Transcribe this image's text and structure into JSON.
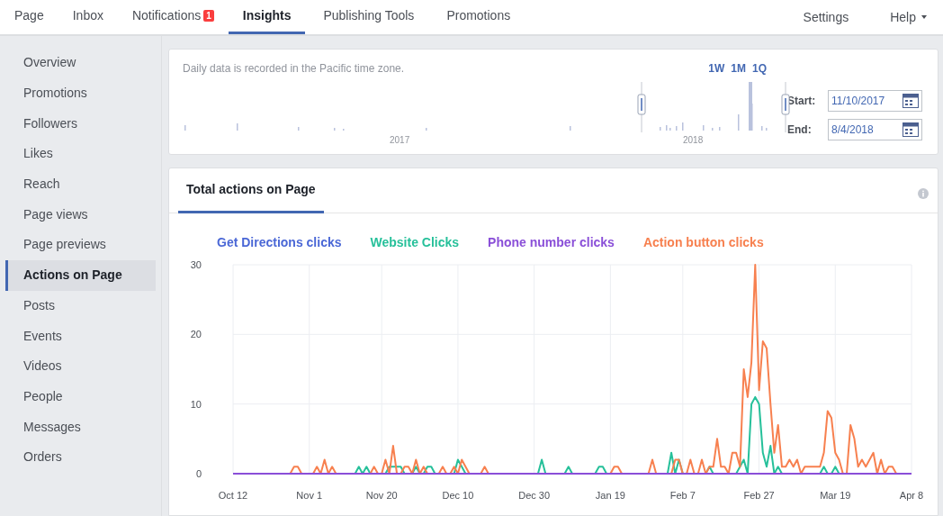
{
  "nav": {
    "tabs": [
      {
        "label": "Page",
        "selected": false
      },
      {
        "label": "Inbox",
        "selected": false
      },
      {
        "label": "Notifications",
        "badge": "1",
        "selected": false
      },
      {
        "label": "Insights",
        "selected": true
      },
      {
        "label": "Publishing Tools",
        "selected": false
      },
      {
        "label": "Promotions",
        "selected": false
      }
    ],
    "right": [
      {
        "label": "Settings",
        "kind": "link"
      },
      {
        "label": "Help",
        "kind": "menu"
      }
    ]
  },
  "sidebar": {
    "items": [
      {
        "label": "Overview",
        "selected": false
      },
      {
        "label": "Promotions",
        "selected": false
      },
      {
        "label": "Followers",
        "selected": false
      },
      {
        "label": "Likes",
        "selected": false
      },
      {
        "label": "Reach",
        "selected": false
      },
      {
        "label": "Page views",
        "selected": false
      },
      {
        "label": "Page previews",
        "selected": false
      },
      {
        "label": "Actions on Page",
        "selected": true
      },
      {
        "label": "Posts",
        "selected": false
      },
      {
        "label": "Events",
        "selected": false
      },
      {
        "label": "Videos",
        "selected": false
      },
      {
        "label": "People",
        "selected": false
      },
      {
        "label": "Messages",
        "selected": false
      },
      {
        "label": "Orders",
        "selected": false
      }
    ]
  },
  "range_card": {
    "note": "Daily data is recorded in the Pacific time zone.",
    "presets": [
      "1W",
      "1M",
      "1Q"
    ],
    "years": [
      "2017",
      "2018"
    ],
    "start": {
      "label": "Start:",
      "value": "11/10/2017"
    },
    "end": {
      "label": "End:",
      "value": "8/4/2018"
    }
  },
  "insights_card": {
    "tab": "Total actions on Page",
    "chart_data": {
      "type": "line",
      "categories": [
        "Oct 12",
        null,
        null,
        null,
        null,
        null,
        null,
        null,
        null,
        null,
        null,
        null,
        null,
        null,
        null,
        null,
        null,
        null,
        null,
        null,
        "Nov 1",
        null,
        null,
        null,
        null,
        null,
        null,
        null,
        null,
        null,
        null,
        null,
        null,
        null,
        null,
        null,
        null,
        null,
        null,
        "Nov 20",
        null,
        null,
        null,
        null,
        null,
        null,
        null,
        null,
        null,
        null,
        null,
        null,
        null,
        null,
        null,
        null,
        null,
        null,
        null,
        "Dec 10",
        null,
        null,
        null,
        null,
        null,
        null,
        null,
        null,
        null,
        null,
        null,
        null,
        null,
        null,
        null,
        null,
        null,
        null,
        null,
        "Dec 30",
        null,
        null,
        null,
        null,
        null,
        null,
        null,
        null,
        null,
        null,
        null,
        null,
        null,
        null,
        null,
        null,
        null,
        null,
        null,
        "Jan 19",
        null,
        null,
        null,
        null,
        null,
        null,
        null,
        null,
        null,
        null,
        null,
        null,
        null,
        null,
        null,
        null,
        null,
        null,
        "Feb 7",
        null,
        null,
        null,
        null,
        null,
        null,
        null,
        null,
        null,
        null,
        null,
        null,
        null,
        null,
        null,
        null,
        null,
        null,
        null,
        "Feb 27",
        null,
        null,
        null,
        null,
        null,
        null,
        null,
        null,
        null,
        null,
        null,
        null,
        null,
        null,
        null,
        null,
        null,
        null,
        null,
        "Mar 19",
        null,
        null,
        null,
        null,
        null,
        null,
        null,
        null,
        null,
        null,
        null,
        null,
        null,
        null,
        null,
        null,
        null,
        null,
        null,
        "Apr 8"
      ],
      "ylim": [
        0,
        30
      ],
      "yticks": [
        0,
        10,
        20,
        30
      ],
      "series": [
        {
          "name": "Get Directions clicks",
          "color": "#4a67d6",
          "values": [
            null,
            null,
            null,
            null,
            null,
            null,
            null,
            null,
            null,
            null,
            null,
            null,
            null,
            null,
            null,
            null,
            null,
            null,
            null,
            null,
            null,
            null,
            null,
            null,
            null,
            null,
            null,
            null,
            null,
            null,
            null,
            null,
            null,
            null,
            null,
            null,
            null,
            null,
            null,
            null,
            null,
            null,
            null,
            null,
            null,
            null,
            null,
            null,
            null,
            null,
            null,
            null,
            null,
            null,
            null,
            null,
            null,
            null,
            null,
            null,
            null,
            null,
            null,
            null,
            null,
            null,
            null,
            null,
            null,
            null,
            null,
            null,
            null,
            null,
            null,
            null,
            null,
            null,
            null,
            null,
            null,
            null,
            null,
            null,
            null,
            null,
            null,
            null,
            null,
            null,
            null,
            null,
            null,
            null,
            null,
            null,
            null,
            null,
            null,
            null,
            null,
            null,
            null,
            null,
            null,
            null,
            null,
            null,
            null,
            null,
            null,
            null,
            null,
            null,
            null,
            null,
            null,
            null,
            null,
            null,
            null,
            null,
            null,
            null,
            null,
            null,
            null,
            null,
            null,
            null,
            null,
            null,
            null,
            null,
            null,
            null,
            null,
            null,
            null,
            null,
            null,
            null,
            null,
            null,
            null,
            null,
            null,
            null,
            null,
            null,
            null,
            null,
            null,
            null,
            null,
            null,
            null,
            null,
            null,
            null,
            null,
            null,
            null,
            null,
            null,
            null,
            null,
            null,
            null,
            null,
            null,
            null,
            null,
            null,
            null,
            null,
            null,
            null,
            null
          ]
        },
        {
          "name": "Website Clicks",
          "color": "#26c09a",
          "values": [
            null,
            null,
            null,
            null,
            null,
            null,
            null,
            null,
            null,
            null,
            null,
            null,
            null,
            null,
            null,
            null,
            null,
            null,
            null,
            null,
            null,
            null,
            null,
            null,
            null,
            null,
            null,
            null,
            null,
            null,
            null,
            null,
            0,
            1,
            0,
            1,
            0,
            null,
            null,
            null,
            0,
            1,
            1,
            1,
            1,
            0,
            null,
            0,
            1,
            0,
            0,
            1,
            1,
            0,
            null,
            null,
            null,
            null,
            0,
            2,
            1,
            0,
            null,
            null,
            null,
            null,
            null,
            null,
            null,
            null,
            null,
            null,
            null,
            null,
            null,
            null,
            null,
            null,
            null,
            null,
            0,
            2,
            0,
            null,
            null,
            null,
            null,
            0,
            1,
            0,
            null,
            null,
            null,
            null,
            null,
            0,
            1,
            1,
            0,
            null,
            null,
            null,
            null,
            null,
            null,
            null,
            null,
            null,
            null,
            null,
            null,
            null,
            null,
            null,
            0,
            3,
            0,
            2,
            0,
            null,
            null,
            null,
            null,
            null,
            0,
            1,
            0,
            null,
            null,
            null,
            null,
            null,
            0,
            1,
            2,
            0,
            10,
            11,
            10,
            3,
            1,
            4,
            0,
            1,
            0,
            null,
            null,
            null,
            null,
            null,
            null,
            null,
            null,
            null,
            0,
            1,
            0,
            0,
            1,
            0,
            null,
            null,
            null,
            null,
            null,
            null,
            null,
            null,
            null,
            null,
            null,
            null,
            null,
            null,
            null,
            null,
            null,
            null,
            null
          ]
        },
        {
          "name": "Phone number clicks",
          "color": "#8a4fd8",
          "values": [
            0,
            0,
            0,
            0,
            0,
            0,
            0,
            0,
            0,
            0,
            0,
            0,
            0,
            0,
            0,
            0,
            0,
            0,
            0,
            0,
            0,
            0,
            0,
            0,
            0,
            0,
            0,
            0,
            0,
            0,
            0,
            0,
            0,
            0,
            0,
            0,
            0,
            0,
            0,
            0,
            0,
            0,
            0,
            0,
            0,
            0,
            0,
            0,
            0,
            0,
            0,
            0,
            0,
            0,
            0,
            0,
            0,
            0,
            0,
            0,
            0,
            0,
            0,
            0,
            0,
            0,
            0,
            0,
            0,
            0,
            0,
            0,
            0,
            0,
            0,
            0,
            0,
            0,
            0,
            0,
            0,
            0,
            0,
            0,
            0,
            0,
            0,
            0,
            0,
            0,
            0,
            0,
            0,
            0,
            0,
            0,
            0,
            0,
            0,
            0,
            0,
            0,
            0,
            0,
            0,
            0,
            0,
            0,
            0,
            0,
            0,
            0,
            0,
            0,
            0,
            0,
            0,
            0,
            0,
            0,
            0,
            0,
            0,
            0,
            0,
            0,
            0,
            0,
            0,
            0,
            0,
            0,
            0,
            0,
            0,
            0,
            0,
            0,
            0,
            0,
            0,
            0,
            0,
            0,
            0,
            0,
            0,
            0,
            0,
            0,
            0,
            0,
            0,
            0,
            0,
            0,
            0,
            0,
            0,
            0,
            0,
            0,
            0,
            0,
            0,
            0,
            0,
            0,
            0,
            0,
            0,
            0,
            0,
            0,
            0,
            0,
            0,
            0,
            0
          ]
        },
        {
          "name": "Action button clicks",
          "color": "#f7804f",
          "values": [
            null,
            null,
            null,
            null,
            null,
            null,
            null,
            null,
            null,
            null,
            null,
            null,
            null,
            null,
            null,
            0,
            1,
            1,
            0,
            null,
            null,
            0,
            1,
            0,
            2,
            0,
            1,
            0,
            null,
            null,
            null,
            null,
            null,
            null,
            null,
            null,
            0,
            1,
            0,
            0,
            2,
            0,
            4,
            0,
            0,
            1,
            1,
            0,
            2,
            0,
            1,
            0,
            null,
            null,
            0,
            1,
            0,
            0,
            1,
            0,
            2,
            1,
            0,
            null,
            null,
            0,
            1,
            0,
            null,
            null,
            null,
            null,
            null,
            null,
            null,
            null,
            null,
            null,
            null,
            null,
            null,
            null,
            null,
            null,
            null,
            null,
            null,
            null,
            null,
            null,
            null,
            null,
            null,
            null,
            null,
            null,
            null,
            null,
            null,
            0,
            1,
            1,
            0,
            null,
            null,
            null,
            null,
            null,
            null,
            0,
            2,
            0,
            null,
            null,
            null,
            0,
            2,
            2,
            0,
            0,
            2,
            0,
            0,
            2,
            0,
            1,
            1,
            5,
            1,
            1,
            0,
            3,
            3,
            1,
            15,
            11,
            16,
            30,
            12,
            19,
            18,
            10,
            3,
            7,
            1,
            1,
            2,
            1,
            2,
            0,
            1,
            1,
            1,
            1,
            1,
            3,
            9,
            8,
            3,
            2,
            0,
            0,
            7,
            5,
            1,
            2,
            1,
            2,
            3,
            0,
            2,
            0,
            1,
            1,
            0,
            null,
            null,
            null,
            null
          ]
        }
      ]
    }
  }
}
